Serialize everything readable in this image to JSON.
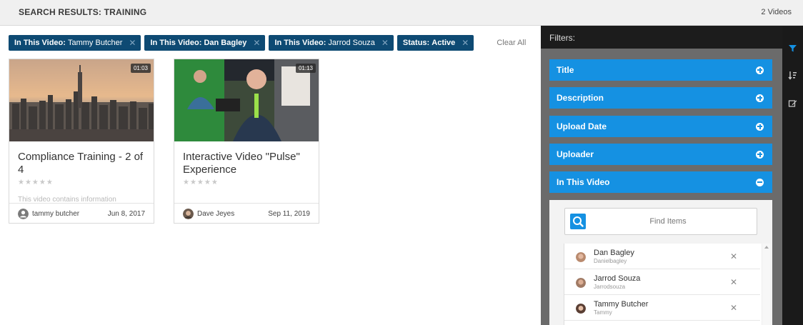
{
  "header": {
    "title": "SEARCH RESULTS: TRAINING",
    "count": "2 Videos"
  },
  "chips": [
    {
      "label": "In This Video:",
      "value": "Tammy Butcher"
    },
    {
      "label": "In This Video:",
      "value": "Dan Bagley"
    },
    {
      "label": "In This Video:",
      "value": "Jarrod Souza"
    },
    {
      "label": "Status:",
      "value": "Active"
    }
  ],
  "clear_all": "Clear All",
  "videos": [
    {
      "duration": "01:03",
      "title": "Compliance Training - 2 of 4",
      "stars": "★★★★★",
      "description": "This video contains information",
      "author": "tammy butcher",
      "date": "Jun 8, 2017"
    },
    {
      "duration": "01:13",
      "title": "Interactive Video \"Pulse\" Experience",
      "stars": "★★★★★",
      "description": "",
      "author": "Dave Jeyes",
      "date": "Sep 11, 2019"
    }
  ],
  "filters": {
    "heading": "Filters:",
    "sections": [
      "Title",
      "Description",
      "Upload Date",
      "Uploader",
      "In This Video"
    ],
    "search_placeholder": "Find Items",
    "people": [
      {
        "name": "Dan Bagley",
        "username": "Danielbagley"
      },
      {
        "name": "Jarrod Souza",
        "username": "Jarrodsouza"
      },
      {
        "name": "Tammy Butcher",
        "username": "Tammy"
      }
    ]
  },
  "colors": {
    "accent": "#1591e2",
    "chip": "#0e4a73",
    "panel": "#6b6b6b",
    "rail": "#1a1a1a"
  },
  "icons": {
    "rail": [
      "filter-icon",
      "sort-icon",
      "edit-icon"
    ],
    "search": "search-icon",
    "remove": "close-icon"
  }
}
